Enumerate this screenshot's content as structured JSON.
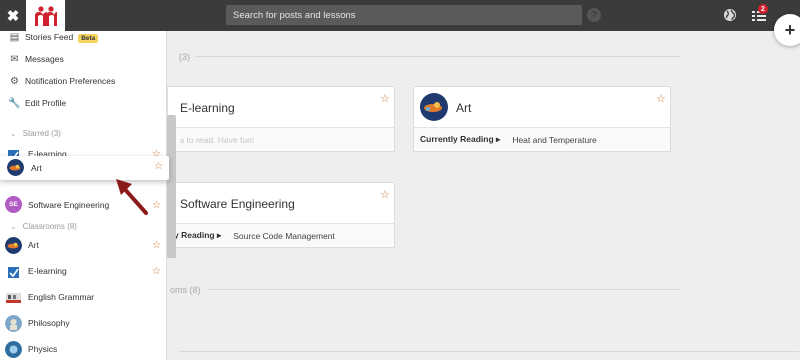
{
  "topbar": {
    "close_icon": "close-icon",
    "search_placeholder": "Search for posts and lessons",
    "help_label": "?",
    "notification_count": "2"
  },
  "fab_label": "+",
  "main": {
    "starred_label": "(3)",
    "classrooms_label": "oms (8)",
    "cards": [
      {
        "title": "E-learning",
        "footer_label": "",
        "footer_value": "s to read. Have fun!"
      },
      {
        "title": "Art",
        "footer_label": "Currently Reading ▸",
        "footer_value": "Heat and Temperature"
      },
      {
        "title": "Software Engineering",
        "footer_label": "y Reading ▸",
        "footer_value": "Source Code Management"
      }
    ]
  },
  "sidebar": {
    "menu": [
      {
        "label": "Stories Feed",
        "badge": "Beta",
        "icon": "feed-icon"
      },
      {
        "label": "Messages",
        "icon": "envelope-icon"
      },
      {
        "label": "Notification Preferences",
        "icon": "gears-icon"
      },
      {
        "label": "Edit Profile",
        "icon": "wrench-icon"
      }
    ],
    "starred_header": "Starred (3)",
    "starred": [
      {
        "label": "E-learning"
      },
      {
        "label": "Art"
      },
      {
        "label": "Software Engineering",
        "avatar_text": "SE"
      }
    ],
    "classrooms_header": "Classrooms (8)",
    "classrooms": [
      {
        "label": "Art"
      },
      {
        "label": "E-learning"
      },
      {
        "label": "English Grammar"
      },
      {
        "label": "Philosophy"
      },
      {
        "label": "Physics"
      }
    ]
  },
  "colors": {
    "topbar": "#3b3b3b",
    "accent_star": "#d4762a",
    "badge": "#d0202b",
    "arrow": "#8b1a1a",
    "beta": "#f4d35e"
  }
}
